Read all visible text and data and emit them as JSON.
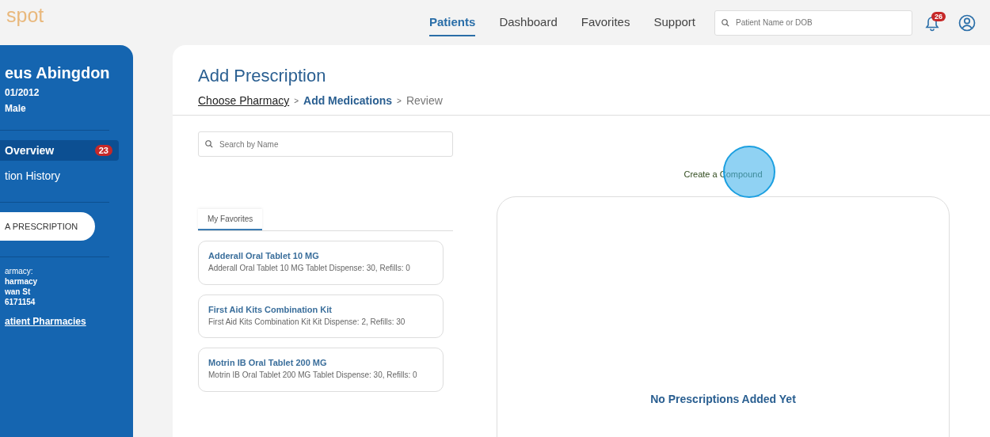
{
  "logo": "spot",
  "nav": [
    {
      "label": "Patients",
      "selected": true
    },
    {
      "label": "Dashboard",
      "selected": false
    },
    {
      "label": "Favorites",
      "selected": false
    },
    {
      "label": "Support",
      "selected": false
    }
  ],
  "patient_search": {
    "placeholder": "Patient Name or DOB"
  },
  "notifications": {
    "count": "26"
  },
  "sidebar": {
    "name": "eus Abingdon",
    "dob": "01/2012",
    "sex": "Male",
    "items": [
      {
        "label": "Overview",
        "badge": "23",
        "selected": true
      },
      {
        "label": "tion History",
        "selected": false
      }
    ],
    "action": "A PRESCRIPTION",
    "pharmacy": [
      "armacy:",
      "harmacy",
      "wan St",
      "6171154"
    ],
    "link": "atient Pharmacies"
  },
  "page": {
    "title": "Add Prescription",
    "steps": [
      {
        "label": "Choose Pharmacy",
        "kind": "done"
      },
      {
        "label": "Add Medications",
        "kind": "current"
      },
      {
        "label": "Review",
        "kind": "todo"
      }
    ],
    "step_separator": ">",
    "med_search": {
      "placeholder": "Search by Name"
    },
    "tabs": [
      {
        "label": "My Favorites",
        "selected": true
      }
    ],
    "favorites": [
      {
        "name": "Adderall Oral Tablet 10 MG",
        "detail": "Adderall Oral Tablet 10 MG Tablet Dispense: 30, Refills: 0"
      },
      {
        "name": "First Aid Kits Combination Kit",
        "detail": "First Aid Kits Combination Kit Kit Dispense: 2, Refills: 30"
      },
      {
        "name": "Motrin IB Oral Tablet 200 MG",
        "detail": "Motrin IB Oral Tablet 200 MG Tablet Dispense: 30, Refills: 0"
      }
    ],
    "compound_link": "Create a Compound",
    "empty_message": "No Prescriptions Added Yet"
  }
}
